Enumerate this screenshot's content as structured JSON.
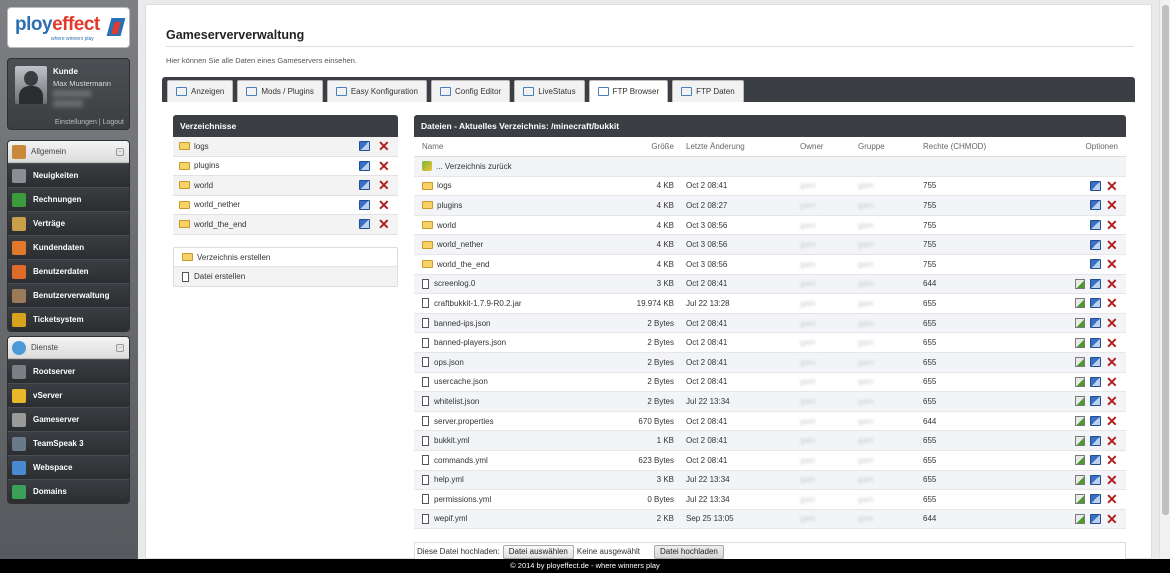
{
  "logo": {
    "brand_a": "ploy",
    "brand_b": "effect",
    "tagline": "where winners play"
  },
  "user": {
    "role": "Kunde",
    "name": "Max Mustermann",
    "settings_link": "Einstellungen",
    "separator": "|",
    "logout_link": "Logout"
  },
  "menu_allgemein": {
    "header": "Allgemein",
    "items": [
      {
        "label": "Neuigkeiten",
        "icon": "news-icon",
        "color": "#8a8f96"
      },
      {
        "label": "Rechnungen",
        "icon": "dollar-icon",
        "color": "#3c9c3c"
      },
      {
        "label": "Verträge",
        "icon": "contract-icon",
        "color": "#c9a04a"
      },
      {
        "label": "Kundendaten",
        "icon": "customer-icon",
        "color": "#e07a2a"
      },
      {
        "label": "Benutzerdaten",
        "icon": "user-data-icon",
        "color": "#e06a2a"
      },
      {
        "label": "Benutzerverwaltung",
        "icon": "user-admin-icon",
        "color": "#9a7a5a"
      },
      {
        "label": "Ticketsystem",
        "icon": "ticket-icon",
        "color": "#d8a21e"
      }
    ]
  },
  "menu_dienste": {
    "header": "Dienste",
    "items": [
      {
        "label": "Rootserver",
        "icon": "server-icon",
        "color": "#7a7f86"
      },
      {
        "label": "vServer",
        "icon": "vserver-icon",
        "color": "#e8b82a"
      },
      {
        "label": "Gameserver",
        "icon": "gamepad-icon",
        "color": "#9a9a9a"
      },
      {
        "label": "TeamSpeak 3",
        "icon": "teamspeak-icon",
        "color": "#6a7a8a"
      },
      {
        "label": "Webspace",
        "icon": "database-icon",
        "color": "#4a8ad0"
      },
      {
        "label": "Domains",
        "icon": "globe-icon",
        "color": "#3aa05a"
      }
    ]
  },
  "page": {
    "title": "Gameserververwaltung",
    "description": "Hier können Sie alle Daten eines Gameservers einsehen."
  },
  "tabs": [
    {
      "label": "Anzeigen",
      "icon": "view-icon"
    },
    {
      "label": "Mods / Plugins",
      "icon": "plugins-icon"
    },
    {
      "label": "Easy Konfiguration",
      "icon": "config-icon"
    },
    {
      "label": "Config Editor",
      "icon": "editor-icon"
    },
    {
      "label": "LiveStatus",
      "icon": "chart-icon"
    },
    {
      "label": "FTP Browser",
      "icon": "ftp-browser-icon",
      "active": true
    },
    {
      "label": "FTP Daten",
      "icon": "ftp-data-icon"
    }
  ],
  "dirs": {
    "header": "Verzeichnisse",
    "items": [
      "logs",
      "plugins",
      "world",
      "world_nether",
      "world_the_end"
    ]
  },
  "dir_actions": {
    "create_dir": "Verzeichnis erstellen",
    "create_file": "Datei erstellen"
  },
  "files": {
    "header": "Dateien - Aktuelles Verzeichnis: /minecraft/bukkit",
    "columns": {
      "name": "Name",
      "size": "Größe",
      "modified": "Letzte Änderung",
      "owner": "Owner",
      "group": "Gruppe",
      "rights": "Rechte (CHMOD)",
      "options": "Optionen"
    },
    "back": "... Verzeichnis zurück",
    "rows": [
      {
        "name": "logs",
        "type": "dir",
        "size": "4 KB",
        "modified": "Oct 2 08:41",
        "owner": "gam",
        "group": "gam",
        "rights": "755"
      },
      {
        "name": "plugins",
        "type": "dir",
        "size": "4 KB",
        "modified": "Oct 2 08:27",
        "owner": "gam",
        "group": "gam",
        "rights": "755"
      },
      {
        "name": "world",
        "type": "dir",
        "size": "4 KB",
        "modified": "Oct 3 08:56",
        "owner": "gam",
        "group": "gam",
        "rights": "755"
      },
      {
        "name": "world_nether",
        "type": "dir",
        "size": "4 KB",
        "modified": "Oct 3 08:56",
        "owner": "gam",
        "group": "gam",
        "rights": "755"
      },
      {
        "name": "world_the_end",
        "type": "dir",
        "size": "4 KB",
        "modified": "Oct 3 08:56",
        "owner": "gam",
        "group": "gam",
        "rights": "755"
      },
      {
        "name": "screenlog.0",
        "type": "file",
        "size": "3 KB",
        "modified": "Oct 2 08:41",
        "owner": "gam",
        "group": "gam",
        "rights": "644"
      },
      {
        "name": "craftbukkit-1.7.9-R0.2.jar",
        "type": "file",
        "size": "19.974 KB",
        "modified": "Jul 22 13:28",
        "owner": "gam",
        "group": "gam",
        "rights": "655"
      },
      {
        "name": "banned-ips.json",
        "type": "file",
        "size": "2 Bytes",
        "modified": "Oct 2 08:41",
        "owner": "gam",
        "group": "gam",
        "rights": "655"
      },
      {
        "name": "banned-players.json",
        "type": "file",
        "size": "2 Bytes",
        "modified": "Oct 2 08:41",
        "owner": "gam",
        "group": "gam",
        "rights": "655"
      },
      {
        "name": "ops.json",
        "type": "file",
        "size": "2 Bytes",
        "modified": "Oct 2 08:41",
        "owner": "gam",
        "group": "gam",
        "rights": "655"
      },
      {
        "name": "usercache.json",
        "type": "file",
        "size": "2 Bytes",
        "modified": "Oct 2 08:41",
        "owner": "gam",
        "group": "gam",
        "rights": "655"
      },
      {
        "name": "whitelist.json",
        "type": "file",
        "size": "2 Bytes",
        "modified": "Jul 22 13:34",
        "owner": "gam",
        "group": "gam",
        "rights": "655"
      },
      {
        "name": "server.properties",
        "type": "file",
        "size": "670 Bytes",
        "modified": "Oct 2 08:41",
        "owner": "gam",
        "group": "gam",
        "rights": "644"
      },
      {
        "name": "bukkit.yml",
        "type": "file",
        "size": "1 KB",
        "modified": "Oct 2 08:41",
        "owner": "gam",
        "group": "gam",
        "rights": "655"
      },
      {
        "name": "commands.yml",
        "type": "file",
        "size": "623 Bytes",
        "modified": "Oct 2 08:41",
        "owner": "gam",
        "group": "gam",
        "rights": "655"
      },
      {
        "name": "help.yml",
        "type": "file",
        "size": "3 KB",
        "modified": "Jul 22 13:34",
        "owner": "gam",
        "group": "gam",
        "rights": "655"
      },
      {
        "name": "permissions.yml",
        "type": "file",
        "size": "0 Bytes",
        "modified": "Jul 22 13:34",
        "owner": "gam",
        "group": "gam",
        "rights": "655"
      },
      {
        "name": "wepif.yml",
        "type": "file",
        "size": "2 KB",
        "modified": "Sep 25 13:05",
        "owner": "gam",
        "group": "gam",
        "rights": "644"
      }
    ]
  },
  "upload": {
    "label": "Diese Datei hochladen:",
    "choose_button": "Datei auswählen",
    "no_file": "Keine ausgewählt",
    "submit_button": "Datei hochladen"
  },
  "footer": "© 2014 by ployeffect.de - where winners play",
  "colors": {
    "dark_bar": "#3b3e42",
    "delete": "#b01e1e",
    "brand_blue": "#2d6fb4",
    "brand_red": "#e23b2b"
  }
}
